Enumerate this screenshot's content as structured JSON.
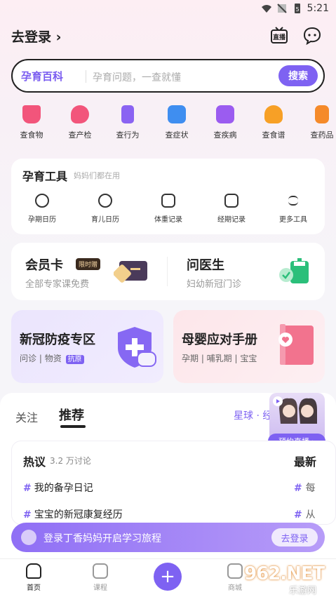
{
  "status_bar": {
    "time": "5:21"
  },
  "header": {
    "login_label": "去登录 ›",
    "live_icon_label": "直播"
  },
  "search": {
    "brand": "孕育百科",
    "placeholder": "孕育问题，一查就懂",
    "button": "搜索"
  },
  "quick_links": [
    {
      "label": "查食物",
      "icon": "cup-icon",
      "color": "#f2557b"
    },
    {
      "label": "查产检",
      "icon": "heart-drop-icon",
      "color": "#f2557b"
    },
    {
      "label": "查行为",
      "icon": "bottle-icon",
      "color": "#8a63f2"
    },
    {
      "label": "查症状",
      "icon": "medical-kit-icon",
      "color": "#3f8ef0"
    },
    {
      "label": "查疾病",
      "icon": "folder-icon",
      "color": "#9b5cf0"
    },
    {
      "label": "查食谱",
      "icon": "bowl-icon",
      "color": "#f7a026"
    },
    {
      "label": "查药品",
      "icon": "pill-bottle-icon",
      "color": "#f58a2a"
    }
  ],
  "tools": {
    "title": "孕育工具",
    "subtitle": "妈妈们都在用",
    "items": [
      {
        "label": "孕期日历",
        "icon": "heart-calendar-icon"
      },
      {
        "label": "育儿日历",
        "icon": "baby-face-icon"
      },
      {
        "label": "体重记录",
        "icon": "scale-icon"
      },
      {
        "label": "经期记录",
        "icon": "period-calendar-icon"
      },
      {
        "label": "更多工具",
        "icon": "menu-lines-icon"
      }
    ]
  },
  "member": {
    "title": "会员卡",
    "badge": "限时赠",
    "subtitle": "全部专家课免费"
  },
  "doctor": {
    "title": "问医生",
    "subtitle": "妇幼新冠门诊"
  },
  "promo_left": {
    "title": "新冠防疫专区",
    "sub_a": "问诊",
    "sub_sep": "|",
    "sub_b": "物资",
    "tag": "抗原"
  },
  "promo_right": {
    "title": "母婴应对手册",
    "subtitle": "孕期 | 哺乳期 | 宝宝"
  },
  "feed": {
    "tabs": {
      "follow": "关注",
      "recommend": "推荐",
      "planet": "星球 · 经"
    },
    "live_button": "预约直播 ›",
    "hot": {
      "title": "热议",
      "count": "3.2 万讨论",
      "new_label": "最新",
      "items": [
        "我的备孕日记",
        "宝宝的新冠康复经历"
      ],
      "right_items": [
        "每",
        "从"
      ]
    }
  },
  "login_banner": {
    "text": "登录丁香妈妈开启学习旅程",
    "button": "去登录"
  },
  "bottom_nav": [
    {
      "label": "首页",
      "icon": "home-icon",
      "active": true
    },
    {
      "label": "课程",
      "icon": "play-book-icon",
      "active": false
    },
    {
      "label": "商城",
      "icon": "shop-icon",
      "active": false
    }
  ],
  "watermark": {
    "big": "962.NET",
    "small": "乐游网"
  },
  "colors": {
    "accent": "#7e62f2",
    "text": "#222222",
    "muted": "#999999"
  }
}
